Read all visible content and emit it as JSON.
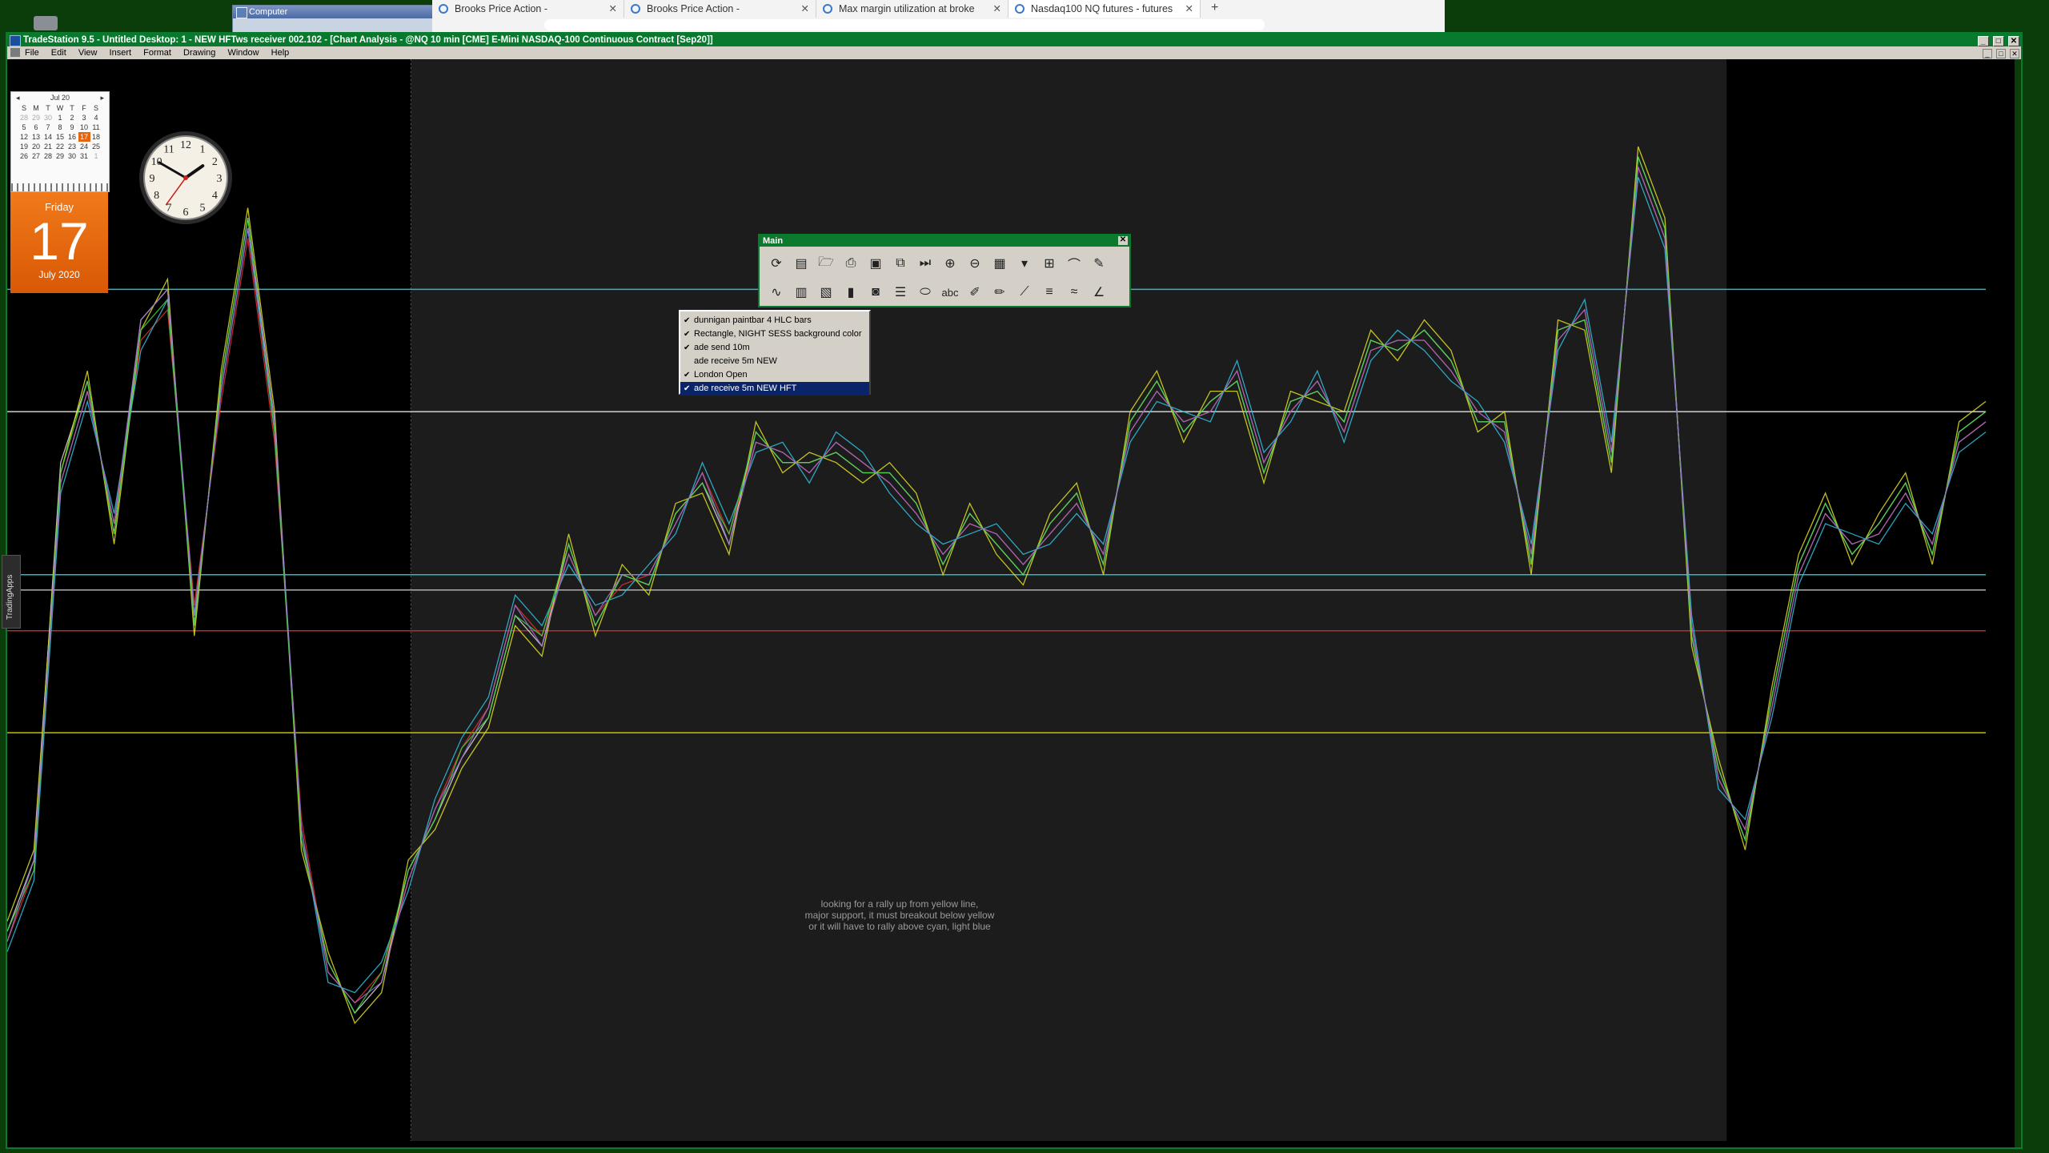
{
  "desktop": {
    "computer_window_title": "Computer"
  },
  "browser": {
    "tabs": [
      {
        "label": "Brooks Price Action -",
        "active": false
      },
      {
        "label": "Brooks Price Action -",
        "active": false
      },
      {
        "label": "Max margin utilization at broke",
        "active": false
      },
      {
        "label": "Nasdaq100 NQ futures - futures",
        "active": true
      }
    ],
    "new_tab": "+"
  },
  "window": {
    "title": "TradeStation 9.5 - Untitled Desktop: 1 - NEW HFTws receiver 002.102 - [Chart Analysis - @NQ 10 min [CME] E-Mini NASDAQ-100 Continuous Contract [Sep20]]",
    "buttons": {
      "minimize": "_",
      "maximize": "□",
      "close": "✕"
    }
  },
  "menu": {
    "items": [
      "File",
      "Edit",
      "View",
      "Insert",
      "Format",
      "Drawing",
      "Window",
      "Help"
    ]
  },
  "side_tab": {
    "label": "TradingApps"
  },
  "calendar": {
    "month_label": "Jul 20",
    "prev": "◂",
    "next": "▸",
    "weekdays": [
      "S",
      "M",
      "T",
      "W",
      "T",
      "F",
      "S"
    ],
    "weeks": [
      [
        "28",
        "29",
        "30",
        "1",
        "2",
        "3",
        "4"
      ],
      [
        "5",
        "6",
        "7",
        "8",
        "9",
        "10",
        "11"
      ],
      [
        "12",
        "13",
        "14",
        "15",
        "16",
        "17",
        "18"
      ],
      [
        "19",
        "20",
        "21",
        "22",
        "23",
        "24",
        "25"
      ],
      [
        "26",
        "27",
        "28",
        "29",
        "30",
        "31",
        "1"
      ]
    ],
    "today": "17",
    "weekday_label": "Friday",
    "day_number": "17",
    "month_year": "July 2020"
  },
  "clock": {
    "hour": 1,
    "minute": 50,
    "second": 36,
    "numerals": [
      "12",
      "1",
      "2",
      "3",
      "4",
      "5",
      "6",
      "7",
      "8",
      "9",
      "10",
      "11"
    ]
  },
  "toolbar": {
    "title": "Main",
    "close": "✕",
    "row1_icons": [
      "refresh-icon",
      "window-icon",
      "open-folder-icon",
      "print-icon",
      "save-icon",
      "copy-page-icon",
      "play-end-icon",
      "zoom-in-icon",
      "zoom-out-icon",
      "color-grid-icon",
      "dropdown-arrow-icon",
      "table-icon",
      "curve-icon",
      "tools-icon"
    ],
    "row2_icons": [
      "indicator-icon",
      "chart-settings-icon",
      "format-icon",
      "color-bars-icon",
      "camera-icon",
      "lines-icon",
      "ellipse-icon",
      "text-tool-icon",
      "highlighter-icon",
      "pencil-icon",
      "trendline-icon",
      "fib-icon",
      "wave-icon",
      "angle-icon"
    ],
    "text_tool_label": "abc"
  },
  "indicator_list": {
    "items": [
      {
        "label": "dunnigan paintbar 4 HLC bars",
        "checked": true,
        "selected": false
      },
      {
        "label": "Rectangle, NIGHT SESS background color",
        "checked": true,
        "selected": false
      },
      {
        "label": "ade send 10m",
        "checked": true,
        "selected": false
      },
      {
        "label": "ade receive 5m NEW",
        "checked": false,
        "selected": false
      },
      {
        "label": "London Open",
        "checked": true,
        "selected": false
      },
      {
        "label": "ade receive 5m NEW HFT",
        "checked": true,
        "selected": true
      }
    ]
  },
  "chart_note": "looking for a rally up from yellow line,\nmajor support, it must breakout below yellow\nor it will have to rally above cyan, light blue",
  "colors": {
    "window_frame": "#0b7a2e",
    "night_session_bg": "#1c1c1c",
    "support_line": "#c8c000",
    "cyan_line": "#28b8c8"
  },
  "chart_data": {
    "type": "line",
    "title": "",
    "xlabel": "",
    "ylabel": "",
    "ylim": [
      0,
      100
    ],
    "x_range": [
      0,
      100
    ],
    "grid": false,
    "legend": "none",
    "session_shading": [
      {
        "from": 20.4,
        "to": 86.9,
        "color": "#1c1c1c"
      }
    ],
    "horizontal_levels": [
      {
        "name": "",
        "y": 35.5,
        "color": "#c8c000"
      },
      {
        "name": "",
        "y": 79.0,
        "color": "#28b8c8"
      },
      {
        "name": "",
        "y": 51.0,
        "color": "#28b8c8"
      },
      {
        "name": "",
        "y": 49.5,
        "color": "#b0b0b0"
      },
      {
        "name": "",
        "y": 45.5,
        "color": "#b03030"
      },
      {
        "name": "",
        "y": 67.0,
        "color": "#d0d0d0"
      }
    ],
    "series": [
      {
        "color": "#dddddd",
        "values": [
          16,
          23,
          62,
          70,
          55,
          76,
          79,
          46,
          70,
          86,
          66,
          25,
          13,
          8,
          11,
          22,
          27,
          33,
          37,
          47,
          44,
          54,
          46,
          51,
          50,
          57,
          60,
          54,
          65,
          62,
          62,
          63,
          61,
          61,
          58,
          52,
          57,
          54,
          51,
          56,
          59,
          52,
          66,
          70,
          65,
          68,
          70,
          61,
          68,
          69,
          66,
          74,
          73,
          75,
          72,
          66,
          66,
          52,
          75,
          76,
          62,
          92,
          85,
          45,
          32,
          25,
          39,
          52,
          58,
          53,
          56,
          60,
          53,
          65,
          67
        ]
      },
      {
        "color": "#e03030",
        "values": [
          15,
          22,
          60,
          69,
          56,
          74,
          77,
          48,
          68,
          84,
          64,
          27,
          12,
          9,
          12,
          21,
          28,
          34,
          38,
          48,
          45,
          53,
          47,
          50,
          51,
          56,
          61,
          55,
          64,
          63,
          61,
          64,
          62,
          60,
          57,
          53,
          56,
          55,
          52,
          55,
          58,
          53,
          65,
          69,
          66,
          67,
          71,
          62,
          67,
          70,
          65,
          73,
          74,
          74,
          71,
          67,
          65,
          53,
          74,
          77,
          63,
          91,
          84,
          46,
          31,
          26,
          38,
          51,
          57,
          54,
          55,
          59,
          54,
          64,
          66
        ]
      },
      {
        "color": "#e0e020",
        "values": [
          17,
          24,
          61,
          71,
          54,
          75,
          80,
          45,
          71,
          87,
          67,
          24,
          14,
          7,
          10,
          23,
          26,
          32,
          36,
          46,
          43,
          55,
          45,
          52,
          49,
          58,
          59,
          53,
          66,
          61,
          63,
          62,
          60,
          62,
          59,
          51,
          58,
          53,
          50,
          57,
          60,
          51,
          67,
          71,
          64,
          69,
          69,
          60,
          69,
          68,
          67,
          75,
          72,
          76,
          73,
          65,
          67,
          51,
          76,
          75,
          61,
          93,
          86,
          44,
          33,
          24,
          40,
          53,
          59,
          52,
          57,
          61,
          52,
          66,
          68
        ]
      },
      {
        "color": "#30c0e0",
        "values": [
          14,
          21,
          59,
          68,
          57,
          73,
          78,
          47,
          69,
          85,
          65,
          26,
          11,
          10,
          13,
          20,
          29,
          35,
          39,
          49,
          46,
          52,
          48,
          49,
          52,
          55,
          62,
          56,
          63,
          64,
          60,
          65,
          63,
          59,
          56,
          54,
          55,
          56,
          53,
          54,
          57,
          54,
          64,
          68,
          67,
          66,
          72,
          63,
          66,
          71,
          64,
          72,
          75,
          73,
          70,
          68,
          64,
          54,
          73,
          78,
          64,
          90,
          83,
          47,
          30,
          27,
          37,
          50,
          56,
          55,
          54,
          58,
          55,
          63,
          65
        ]
      },
      {
        "color": "#40d040",
        "values": [
          16,
          22,
          61,
          70,
          55,
          75,
          78,
          46,
          70,
          86,
          65,
          25,
          13,
          8,
          12,
          22,
          27,
          34,
          37,
          47,
          45,
          54,
          46,
          51,
          50,
          57,
          60,
          55,
          65,
          62,
          62,
          63,
          61,
          61,
          58,
          52,
          57,
          54,
          51,
          56,
          59,
          52,
          66,
          70,
          65,
          68,
          70,
          61,
          68,
          69,
          66,
          74,
          73,
          75,
          72,
          66,
          66,
          52,
          75,
          76,
          62,
          92,
          85,
          45,
          32,
          25,
          39,
          52,
          58,
          53,
          56,
          60,
          53,
          65,
          67
        ]
      },
      {
        "color": "#a070d0",
        "values": [
          15,
          23,
          60,
          69,
          56,
          76,
          79,
          47,
          69,
          85,
          66,
          26,
          12,
          9,
          11,
          21,
          28,
          33,
          38,
          48,
          44,
          53,
          47,
          51,
          51,
          56,
          61,
          54,
          64,
          63,
          61,
          64,
          62,
          60,
          57,
          53,
          56,
          55,
          52,
          55,
          58,
          53,
          65,
          69,
          66,
          67,
          71,
          62,
          67,
          70,
          65,
          73,
          74,
          74,
          71,
          67,
          65,
          53,
          74,
          77,
          63,
          91,
          84,
          46,
          31,
          26,
          38,
          51,
          57,
          54,
          55,
          59,
          54,
          64,
          66
        ]
      }
    ]
  }
}
